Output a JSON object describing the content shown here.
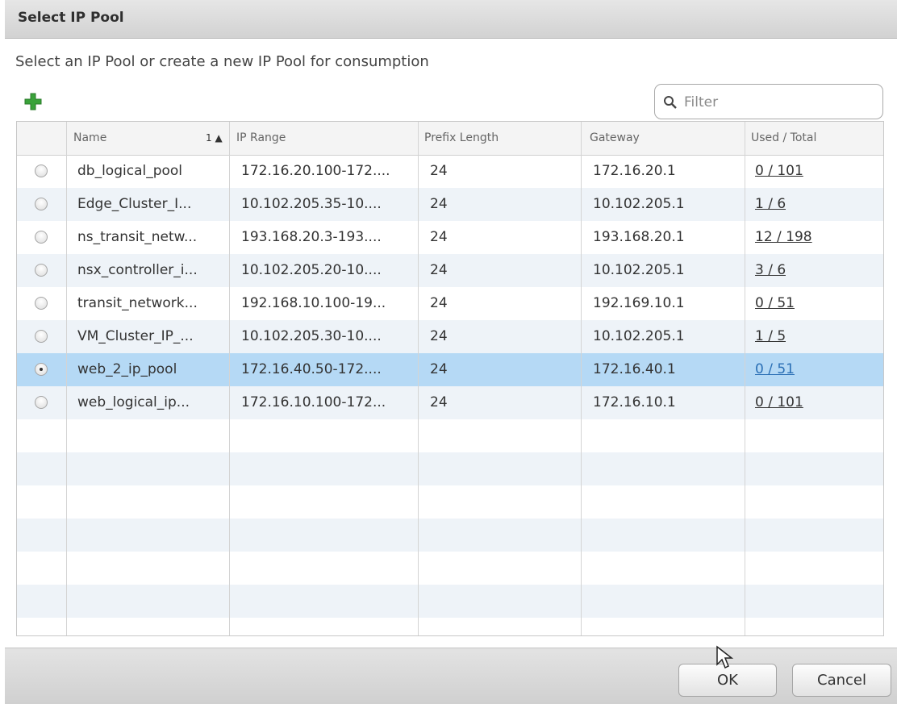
{
  "dialog": {
    "title": "Select IP Pool",
    "instruction": "Select an IP Pool or create a new IP Pool for consumption"
  },
  "toolbar": {
    "add_icon": "green-plus-icon",
    "filter_placeholder": "Filter",
    "filter_icon": "search-icon"
  },
  "table": {
    "columns": {
      "name": "Name",
      "sort_indicator": "1 ▲",
      "ip_range": "IP Range",
      "prefix_length": "Prefix Length",
      "gateway": "Gateway",
      "used_total": "Used / Total"
    },
    "rows": [
      {
        "name": "db_logical_pool",
        "ip_range": "172.16.20.100-172....",
        "prefix": "24",
        "gateway": "172.16.20.1",
        "used_total": "0 / 101",
        "selected": false
      },
      {
        "name": "Edge_Cluster_I...",
        "ip_range": "10.102.205.35-10....",
        "prefix": "24",
        "gateway": "10.102.205.1",
        "used_total": "1 / 6",
        "selected": false
      },
      {
        "name": "ns_transit_netw...",
        "ip_range": "193.168.20.3-193....",
        "prefix": "24",
        "gateway": "193.168.20.1",
        "used_total": "12 / 198",
        "selected": false
      },
      {
        "name": "nsx_controller_i...",
        "ip_range": "10.102.205.20-10....",
        "prefix": "24",
        "gateway": "10.102.205.1",
        "used_total": "3 / 6",
        "selected": false
      },
      {
        "name": "transit_network...",
        "ip_range": "192.168.10.100-19...",
        "prefix": "24",
        "gateway": "192.169.10.1",
        "used_total": "0 / 51",
        "selected": false
      },
      {
        "name": "VM_Cluster_IP_...",
        "ip_range": "10.102.205.30-10....",
        "prefix": "24",
        "gateway": "10.102.205.1",
        "used_total": "1 / 5",
        "selected": false
      },
      {
        "name": "web_2_ip_pool",
        "ip_range": "172.16.40.50-172....",
        "prefix": "24",
        "gateway": "172.16.40.1",
        "used_total": "0 / 51",
        "selected": true
      },
      {
        "name": "web_logical_ip...",
        "ip_range": "172.16.10.100-172...",
        "prefix": "24",
        "gateway": "172.16.10.1",
        "used_total": "0 / 101",
        "selected": false
      }
    ]
  },
  "footer": {
    "ok_label": "OK",
    "cancel_label": "Cancel"
  },
  "colors": {
    "selected_row": "#b5d9f5",
    "alt_row": "#eef3f8",
    "add_icon": "#3aa23a"
  }
}
